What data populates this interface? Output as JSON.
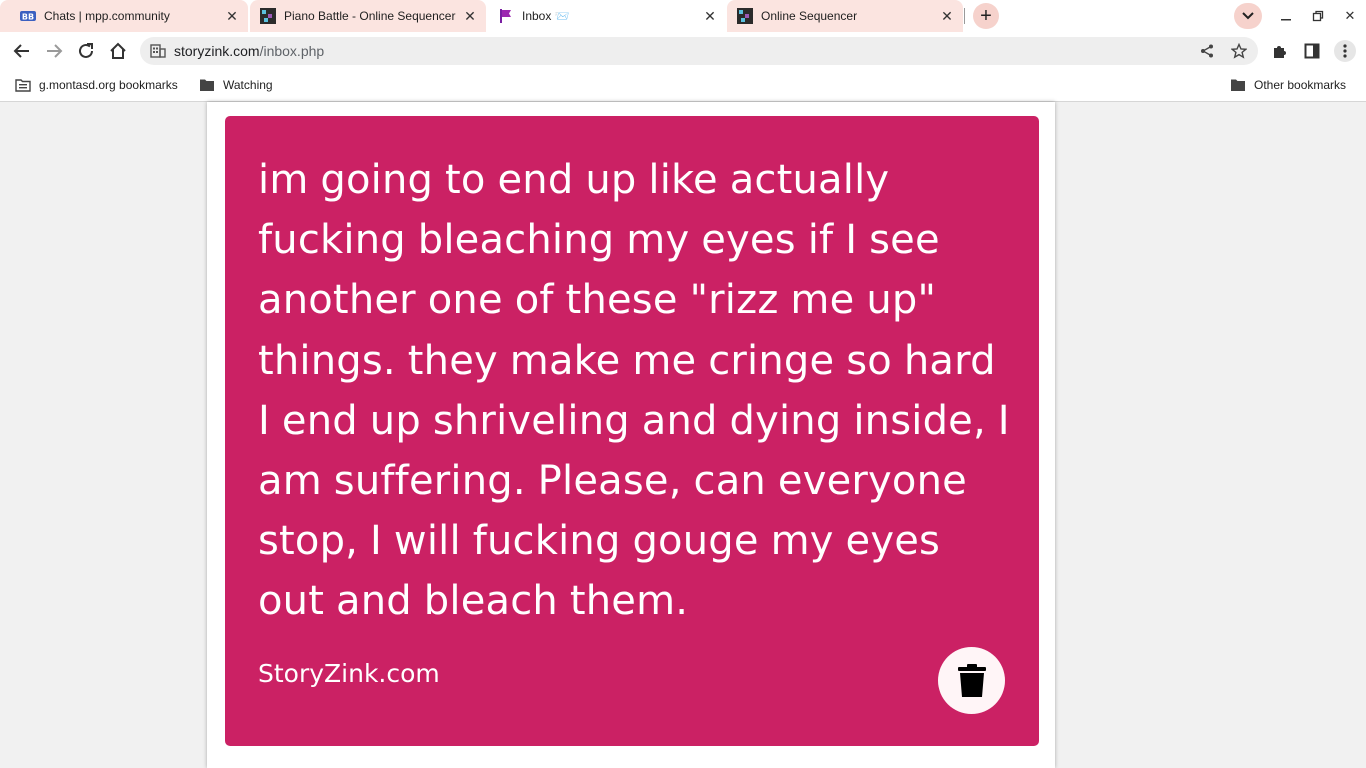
{
  "browser": {
    "tabs": [
      {
        "title": "Chats | mpp.community",
        "favicon": "bb-icon",
        "active": false
      },
      {
        "title": "Piano Battle - Online Sequencer",
        "favicon": "sequencer-icon",
        "active": false
      },
      {
        "title": "Inbox 📨",
        "favicon": "flag-icon",
        "active": true
      },
      {
        "title": "Online Sequencer",
        "favicon": "sequencer-icon",
        "active": false
      }
    ],
    "url_host": "storyzink.com",
    "url_path": "/inbox.php",
    "bookmarks": [
      {
        "label": "g.montasd.org bookmarks",
        "icon": "bookmark-folder-icon"
      },
      {
        "label": "Watching",
        "icon": "folder-icon"
      }
    ],
    "other_bookmarks": "Other bookmarks",
    "accent": "#fbe4e0"
  },
  "card": {
    "message": "im going to end up like actually fucking bleaching my eyes if I see another one of these \"rizz me up\" things. they make me cringe so hard I end up shriveling and dying inside, I am suffering. Please, can everyone stop, I will fucking gouge my eyes out and bleach them.",
    "brand": "StoryZink.com",
    "background": "#cb2164",
    "delete_icon": "trash-icon"
  }
}
